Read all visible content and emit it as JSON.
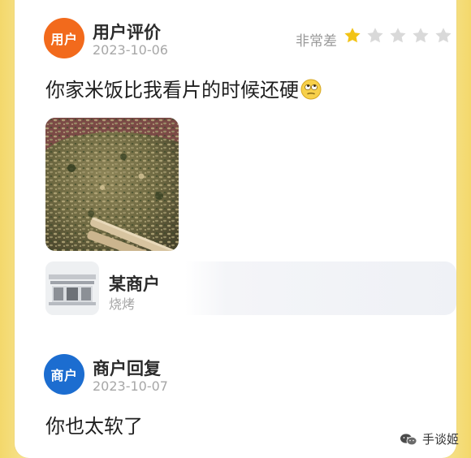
{
  "review": {
    "avatar_label": "用户",
    "title": "用户评价",
    "date": "2023-10-06",
    "rating_label": "非常差",
    "rating": 1,
    "max_rating": 5,
    "comment": "你家米饭比我看片的时候还硬",
    "emoji": "rolling-eyes-emoji"
  },
  "merchant_card": {
    "name": "某商户",
    "category": "烧烤",
    "icon": "storefront-icon"
  },
  "reply": {
    "avatar_label": "商户",
    "title": "商户回复",
    "date": "2023-10-07",
    "comment": "你也太软了"
  },
  "watermark": {
    "text": "手谈姬"
  },
  "colors": {
    "user_avatar": "#f26a1c",
    "merchant_avatar": "#1c6dd0",
    "star_filled": "#f2c316",
    "star_empty": "#d9d9d9",
    "background": "#f7df74"
  }
}
